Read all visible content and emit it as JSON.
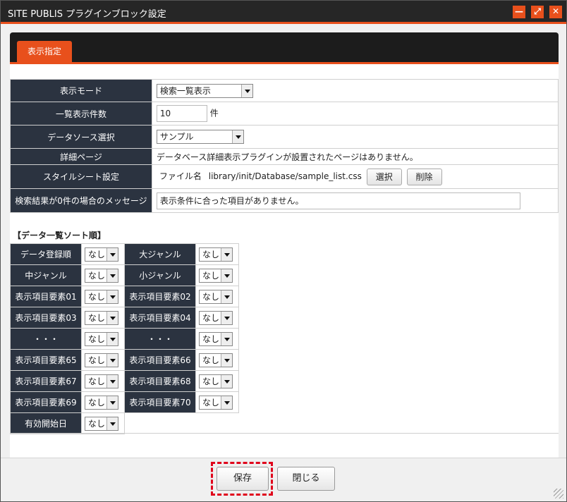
{
  "window": {
    "title": "SITE PUBLIS プラグインブロック設定",
    "controls": {
      "minimize": "—",
      "maximize": "⤢",
      "close": "✕"
    },
    "accent_color": "#e8501c"
  },
  "tabs": [
    {
      "label": "表示指定",
      "active": true
    }
  ],
  "settings": {
    "display_mode": {
      "label": "表示モード",
      "value": "検索一覧表示"
    },
    "list_count": {
      "label": "一覧表示件数",
      "value": "10",
      "unit": "件"
    },
    "data_source": {
      "label": "データソース選択",
      "value": "サンプル"
    },
    "detail_page": {
      "label": "詳細ページ",
      "value": "データベース詳細表示プラグインが設置されたページはありません。"
    },
    "stylesheet": {
      "label": "スタイルシート設定",
      "file_label": "ファイル名",
      "file_value": "library/init/Database/sample_list.css",
      "select_button": "選択",
      "delete_button": "削除"
    },
    "no_result_message": {
      "label": "検索結果が0件の場合のメッセージ",
      "value": "表示条件に合った項目がありません。"
    }
  },
  "sort": {
    "heading": "【データ一覧ソート順】",
    "default_value": "なし",
    "rows": [
      [
        {
          "label": "データ登録順",
          "value": "なし"
        },
        {
          "label": "大ジャンル",
          "value": "なし"
        }
      ],
      [
        {
          "label": "中ジャンル",
          "value": "なし"
        },
        {
          "label": "小ジャンル",
          "value": "なし"
        }
      ],
      [
        {
          "label": "表示項目要素01",
          "value": "なし"
        },
        {
          "label": "表示項目要素02",
          "value": "なし"
        }
      ],
      [
        {
          "label": "表示項目要素03",
          "value": "なし"
        },
        {
          "label": "表示項目要素04",
          "value": "なし"
        }
      ],
      [
        {
          "label": "・・・",
          "value": "なし"
        },
        {
          "label": "・・・",
          "value": "なし"
        }
      ],
      [
        {
          "label": "表示項目要素65",
          "value": "なし"
        },
        {
          "label": "表示項目要素66",
          "value": "なし"
        }
      ],
      [
        {
          "label": "表示項目要素67",
          "value": "なし"
        },
        {
          "label": "表示項目要素68",
          "value": "なし"
        }
      ],
      [
        {
          "label": "表示項目要素69",
          "value": "なし"
        },
        {
          "label": "表示項目要素70",
          "value": "なし"
        }
      ],
      [
        {
          "label": "有効開始日",
          "value": "なし"
        }
      ]
    ]
  },
  "footer": {
    "save_label": "保存",
    "close_label": "閉じる"
  }
}
